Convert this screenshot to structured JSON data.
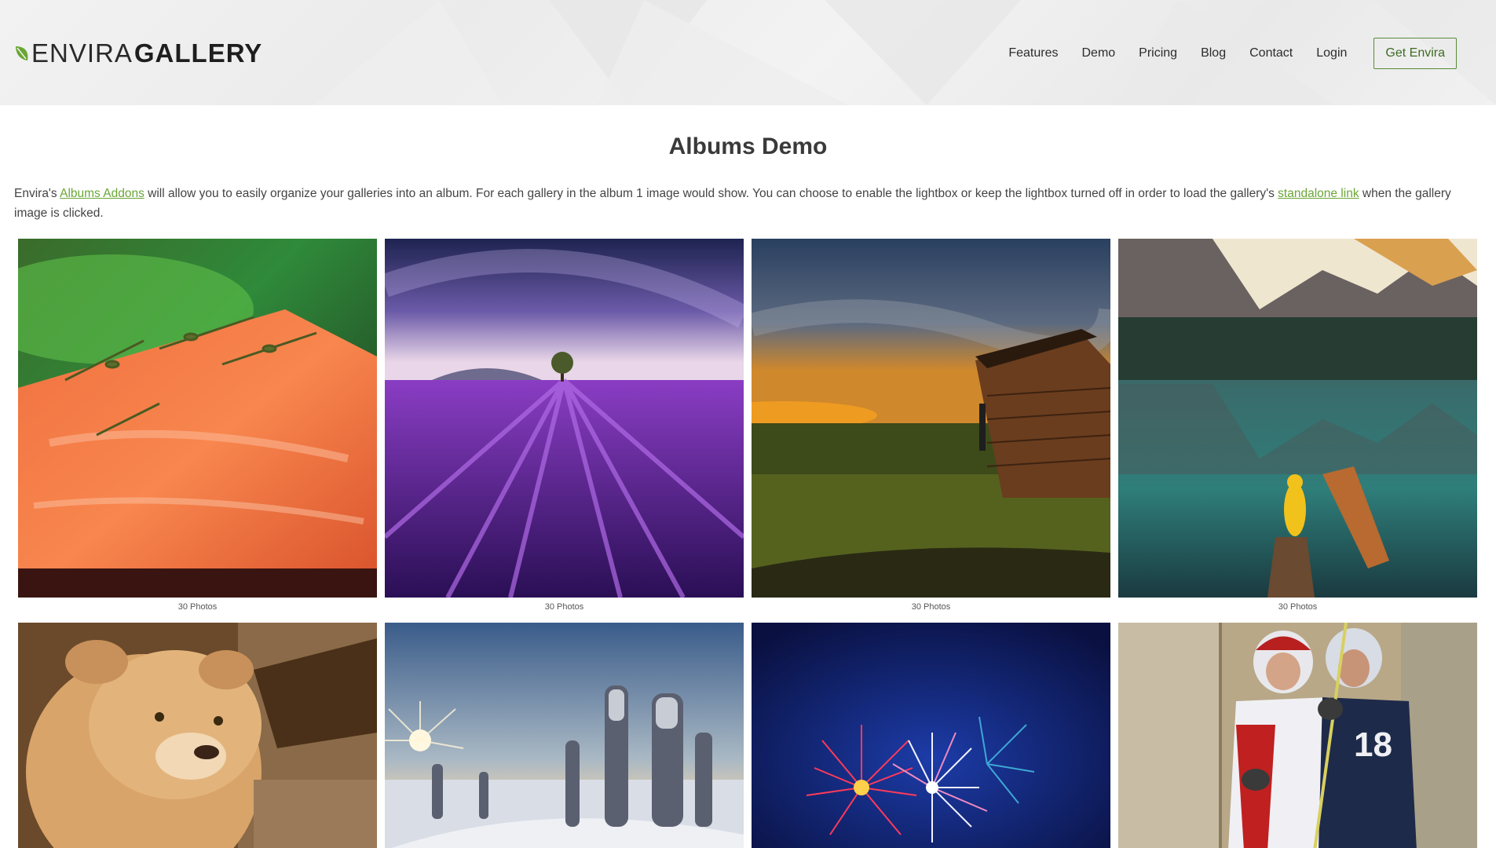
{
  "header": {
    "logo": {
      "light": "ENVIRA",
      "bold": "GALLERY"
    },
    "nav": [
      "Features",
      "Demo",
      "Pricing",
      "Blog",
      "Contact",
      "Login"
    ],
    "cta": "Get Envira"
  },
  "page": {
    "title": "Albums Demo",
    "intro": {
      "p1": "Envira's ",
      "link1": "Albums Addons",
      "p2": " will allow you to easily organize your galleries into an album. For each gallery in the album 1 image would show. You can choose to enable the lightbox or keep the lightbox turned off in order to load the gallery's ",
      "link2": "standalone link",
      "p3": " when the gallery image is clicked."
    }
  },
  "albums": [
    {
      "image": "salmon-herbs",
      "caption": "30 Photos"
    },
    {
      "image": "lavender-field-night",
      "caption": "30 Photos"
    },
    {
      "image": "cabin-sunset",
      "caption": "30 Photos"
    },
    {
      "image": "mountain-lake-boat",
      "caption": "30 Photos"
    },
    {
      "image": "lioness",
      "caption": ""
    },
    {
      "image": "snowy-trees-sun",
      "caption": ""
    },
    {
      "image": "fireworks",
      "caption": ""
    },
    {
      "image": "lacrosse-players",
      "caption": ""
    }
  ],
  "colors": {
    "accent": "#6aa636",
    "cta_border": "#5a8a3a"
  }
}
